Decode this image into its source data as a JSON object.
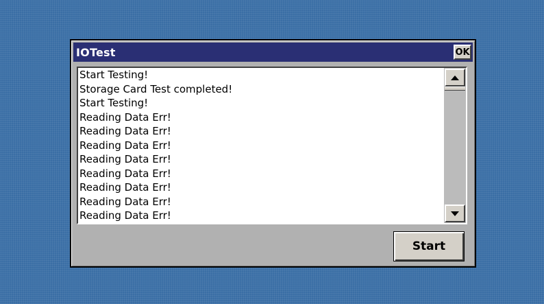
{
  "window": {
    "title": "IOTest",
    "ok_label": "OK"
  },
  "log": {
    "items": [
      "Start Testing!",
      "Storage Card Test completed!",
      "Start Testing!",
      "Reading Data Err!",
      "Reading Data Err!",
      "Reading Data Err!",
      "Reading Data Err!",
      "Reading Data Err!",
      "Reading Data Err!",
      "Reading Data Err!",
      "Reading Data Err!"
    ]
  },
  "scrollbar": {
    "up_icon": "arrow-up",
    "down_icon": "arrow-down"
  },
  "actions": {
    "start_label": "Start"
  },
  "colors": {
    "desktop": "#3a6ea5",
    "titlebar": "#2a2f74",
    "window": "#c0c0c0"
  }
}
